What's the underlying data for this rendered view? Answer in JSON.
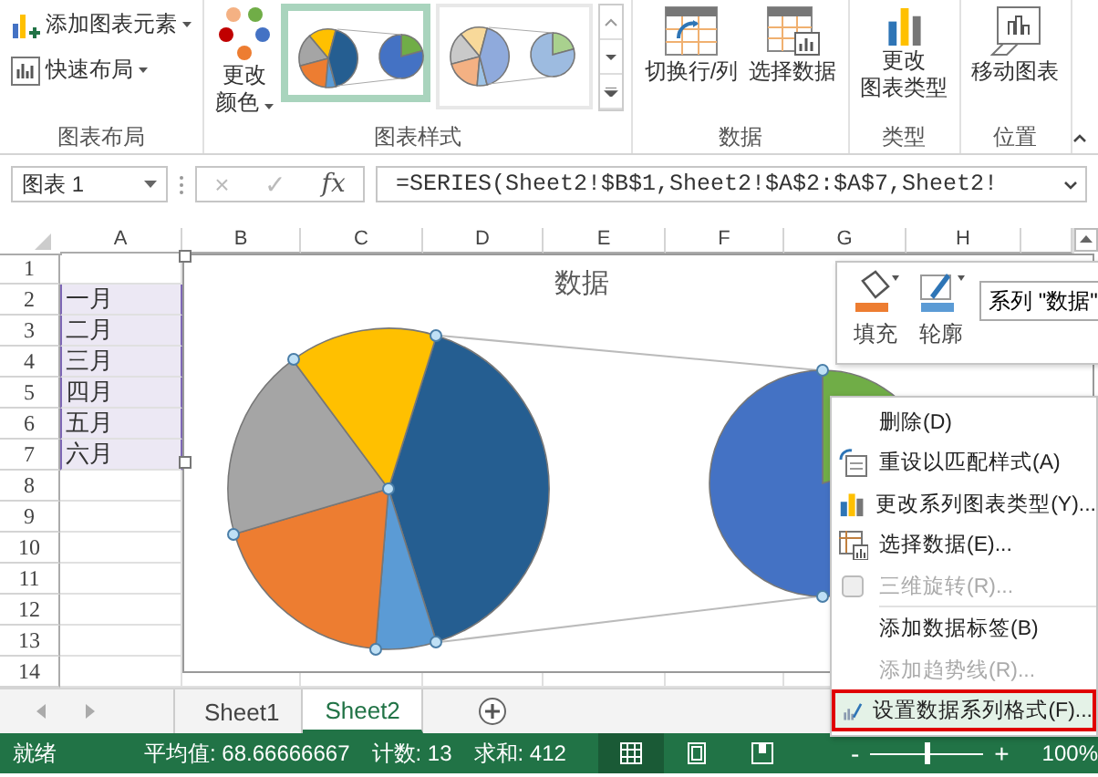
{
  "ribbon": {
    "groups": [
      {
        "label": "图表布局",
        "items": [
          {
            "kind": "small",
            "lines": [
              "添加图表元素"
            ],
            "dropdown": true
          },
          {
            "kind": "small",
            "lines": [
              "快速布局"
            ],
            "dropdown": true
          }
        ]
      },
      {
        "label": "图表样式",
        "items": [
          {
            "kind": "big",
            "lines": [
              "更改",
              "颜色"
            ],
            "dropdown": true
          },
          {
            "kind": "gallery",
            "styles": [
              {
                "selected": true
              },
              {
                "selected": false
              }
            ]
          }
        ]
      },
      {
        "label": "数据",
        "items": [
          {
            "kind": "big",
            "lines": [
              "切换行/列"
            ],
            "dropdown": false
          },
          {
            "kind": "big",
            "lines": [
              "选择数据"
            ],
            "dropdown": false
          }
        ]
      },
      {
        "label": "类型",
        "items": [
          {
            "kind": "big",
            "lines": [
              "更改",
              "图表类型"
            ],
            "dropdown": false
          }
        ]
      },
      {
        "label": "位置",
        "items": [
          {
            "kind": "big",
            "lines": [
              "移动图表"
            ],
            "dropdown": false
          }
        ]
      }
    ]
  },
  "formula_bar": {
    "name_box": "图表 1",
    "cancel": "×",
    "enter": "✓",
    "function": "fx",
    "edit_buttons_disabled": true,
    "formula": "=SERIES(Sheet2!$B$1,Sheet2!$A$2:$A$7,Sheet2!"
  },
  "sheet": {
    "columns": [
      "A",
      "B",
      "C",
      "D",
      "E",
      "F",
      "G",
      "H"
    ],
    "rows": [
      {
        "number": "1"
      },
      {
        "number": "2",
        "cells": [
          {
            "text": "一月",
            "highlighted": true
          }
        ]
      },
      {
        "number": "3",
        "cells": [
          {
            "text": "二月",
            "highlighted": true
          }
        ]
      },
      {
        "number": "4",
        "cells": [
          {
            "text": "三月",
            "highlighted": true
          }
        ]
      },
      {
        "number": "5",
        "cells": [
          {
            "text": "四月",
            "highlighted": true
          }
        ]
      },
      {
        "number": "6",
        "cells": [
          {
            "text": "五月",
            "highlighted": true
          }
        ]
      },
      {
        "number": "7",
        "cells": [
          {
            "text": "六月",
            "highlighted": true
          }
        ]
      },
      {
        "number": "8"
      },
      {
        "number": "9"
      },
      {
        "number": "10"
      },
      {
        "number": "11"
      },
      {
        "number": "12"
      },
      {
        "number": "13"
      },
      {
        "number": "14"
      }
    ]
  },
  "chart": {
    "title": "数据",
    "selected": true
  },
  "mini_toolbar": {
    "fill": "填充",
    "outline": "轮廓",
    "series": "系列 \"数据\""
  },
  "context_menu": [
    {
      "label": "删除(D)",
      "disabled": false,
      "selected": false
    },
    {
      "label": "重设以匹配样式(A)",
      "disabled": false,
      "selected": false
    },
    {
      "label": "更改系列图表类型(Y)...",
      "disabled": false,
      "selected": false
    },
    {
      "label": "选择数据(E)...",
      "disabled": false,
      "selected": false
    },
    {
      "label": "三维旋转(R)...",
      "disabled": true,
      "selected": false
    },
    {
      "label": "添加数据标签(B)",
      "disabled": false,
      "selected": false
    },
    {
      "label": "添加趋势线(R)...",
      "disabled": true,
      "selected": false
    },
    {
      "label": "设置数据系列格式(F)...",
      "disabled": false,
      "selected": true
    }
  ],
  "sheet_tabs": [
    {
      "label": "Sheet1",
      "selected": false
    },
    {
      "label": "Sheet2",
      "selected": true
    }
  ],
  "status_bar": {
    "ready": "就绪",
    "average": "平均值: 68.66666667",
    "count": "计数: 13",
    "sum": "求和: 412",
    "views": [
      {
        "selected": true
      },
      {
        "selected": false
      },
      {
        "selected": false
      }
    ],
    "zoom_out": "-",
    "zoom": {
      "level": 0.5
    },
    "zoom_in": "+",
    "zoom_percent": "100%"
  }
}
